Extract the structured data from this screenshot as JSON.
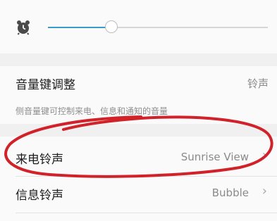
{
  "volume_slider": {
    "icon": "alarm-clock-icon",
    "level": 0.29
  },
  "volume_keys": {
    "title": "音量键调整",
    "value": "铃声",
    "description": "侧音量键可控制来电、信息和通知的音量"
  },
  "ringtone": {
    "title": "来电铃声",
    "value": "Sunrise View"
  },
  "message_tone": {
    "title": "信息铃声",
    "value": "Bubble"
  },
  "colors": {
    "accent": "#3a9ccb",
    "annotation": "#d1222a"
  }
}
